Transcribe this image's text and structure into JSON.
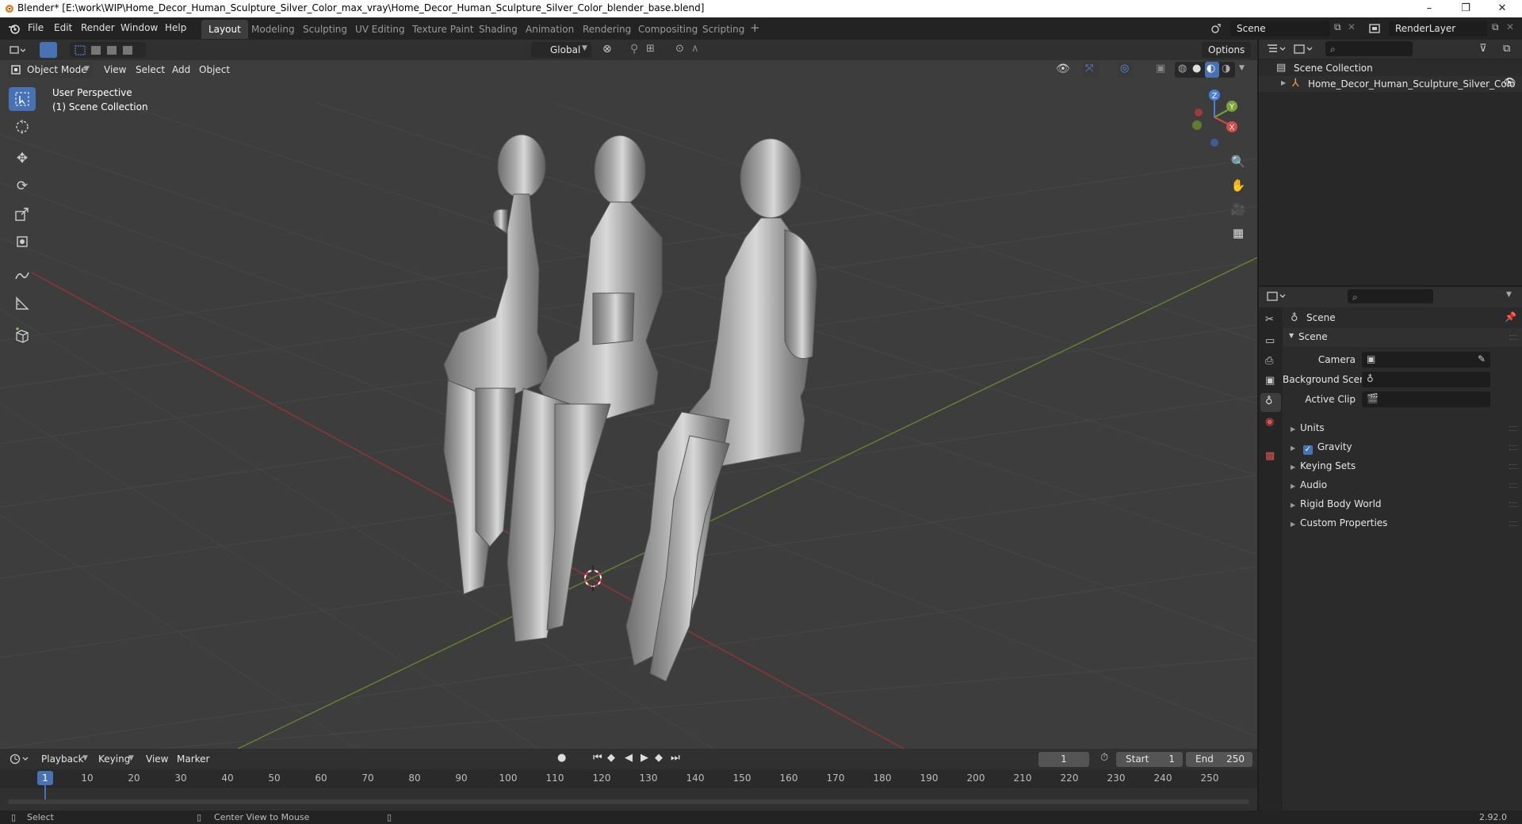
{
  "window": {
    "title": "Blender* [E:\\work\\WIP\\Home_Decor_Human_Sculpture_Silver_Color_max_vray\\Home_Decor_Human_Sculpture_Silver_Color_blender_base.blend]"
  },
  "menu": [
    "File",
    "Edit",
    "Render",
    "Window",
    "Help"
  ],
  "workspaces": [
    "Layout",
    "Modeling",
    "Sculpting",
    "UV Editing",
    "Texture Paint",
    "Shading",
    "Animation",
    "Rendering",
    "Compositing",
    "Scripting"
  ],
  "active_workspace": "Layout",
  "scene_name": "Scene",
  "view_layer": "RenderLayer",
  "viewport": {
    "transform_orientation": "Global",
    "options_label": "Options",
    "mode": "Object Mode",
    "header_menus": [
      "View",
      "Select",
      "Add",
      "Object"
    ],
    "perspective_label": "User Perspective",
    "collection_label": "(1) Scene Collection",
    "gizmo_axes": [
      "Z",
      "Y",
      "X"
    ]
  },
  "outliner": {
    "root": "Scene Collection",
    "items": [
      "Home_Decor_Human_Sculpture_Silver_Colo"
    ]
  },
  "properties": {
    "context": "Scene",
    "panel": "Scene",
    "fields": {
      "camera": "Camera",
      "background_scene": "Background Scene",
      "active_clip": "Active Clip"
    },
    "subpanels": [
      "Units",
      "Gravity",
      "Keying Sets",
      "Audio",
      "Rigid Body World",
      "Custom Properties"
    ],
    "gravity_checked": true
  },
  "timeline": {
    "menus": [
      "Playback",
      "Keying",
      "View",
      "Marker"
    ],
    "current_frame": "1",
    "start_label": "Start",
    "start": "1",
    "end_label": "End",
    "end": "250",
    "ticks": [
      "1",
      "10",
      "20",
      "30",
      "40",
      "50",
      "60",
      "70",
      "80",
      "90",
      "100",
      "110",
      "120",
      "130",
      "140",
      "150",
      "160",
      "170",
      "180",
      "190",
      "200",
      "210",
      "220",
      "230",
      "240",
      "250"
    ]
  },
  "statusbar": {
    "left": "Select",
    "middle": "Center View to Mouse",
    "version": "2.92.0"
  },
  "colors": {
    "accent": "#4772b3",
    "x_axis": "#d94a4a",
    "y_axis": "#7da33a",
    "z_axis": "#4a7fd9",
    "viewport_bg": "#3d3d3d"
  }
}
